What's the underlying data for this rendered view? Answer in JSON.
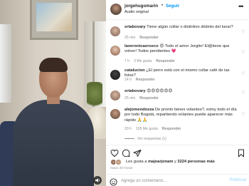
{
  "post": {
    "username": "jorgehugomarin",
    "separator": "•",
    "follow_label": "Seguir",
    "audio_label": "Audio original",
    "more_icon": "more-horizontal-icon"
  },
  "comments": [
    {
      "username": "srtabovary",
      "text": "Tiene algún collar o distintivo distinto del lunar?",
      "time": "25 min",
      "likes": "",
      "reply": "Responder"
    },
    {
      "username": "laveronicaorozco",
      "text": "😍 Todo el amor Jorgito! El@tiene que volver! Todos pendientes 💗",
      "time": "7 h",
      "likes": "3 Me gusta",
      "reply": "Responder"
    },
    {
      "username": "catalucion",
      "text": "¿El perro está con el mismo collar café de las fotos?",
      "time": "14 h",
      "likes": "",
      "reply": "Responder"
    },
    {
      "username": "srtabovary",
      "text": "😍😍😍😍😍😍",
      "time": "25 min",
      "likes": "",
      "reply": "Responder"
    },
    {
      "username": "alejomendozza",
      "text": "De pronto tienes volantes?, estoy todo el día por todo Bogotá, repartiendo volantes puede aparecer más rápido 🙏🙏",
      "time": "20 h",
      "likes": "105 Me gusta",
      "reply": "Responder"
    }
  ],
  "view_replies": "Ver respuestas (1)",
  "actions": {
    "like_icon": "heart-icon",
    "comment_icon": "comment-icon",
    "share_icon": "share-icon",
    "save_icon": "bookmark-icon"
  },
  "likes": {
    "prefix": "Les gusta a ",
    "user": "majoarjonam",
    "suffix": " y ",
    "count": "3224 personas más"
  },
  "time_ago": "Hace 20 horas",
  "add_comment": {
    "placeholder": "Agrega un comentario...",
    "post_label": "Publicar"
  },
  "video": {
    "mute_icon": "volume-icon"
  }
}
